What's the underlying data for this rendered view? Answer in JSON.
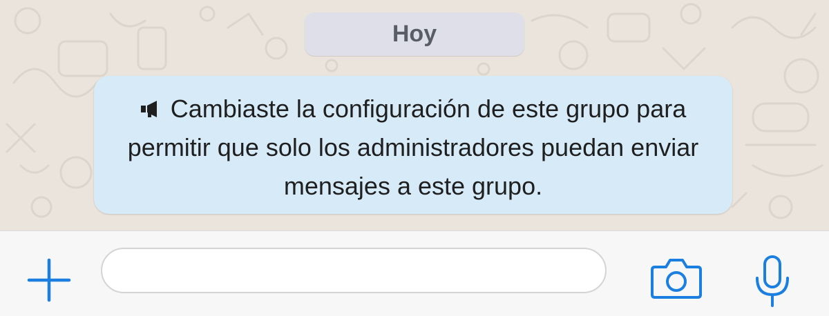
{
  "chat": {
    "date_label": "Hoy",
    "system_message": {
      "icon": "megaphone-icon",
      "text": "Cambiaste la configuración de este grupo para permitir que solo los administradores puedan enviar mensajes a este grupo."
    }
  },
  "input_bar": {
    "attach_icon": "plus-icon",
    "message_value": "",
    "camera_icon": "camera-icon",
    "mic_icon": "microphone-icon"
  },
  "colors": {
    "accent": "#1a7fe0",
    "chat_background": "#eae4dc",
    "date_chip": "#dedfe9",
    "system_bubble": "#d6eaf8"
  }
}
